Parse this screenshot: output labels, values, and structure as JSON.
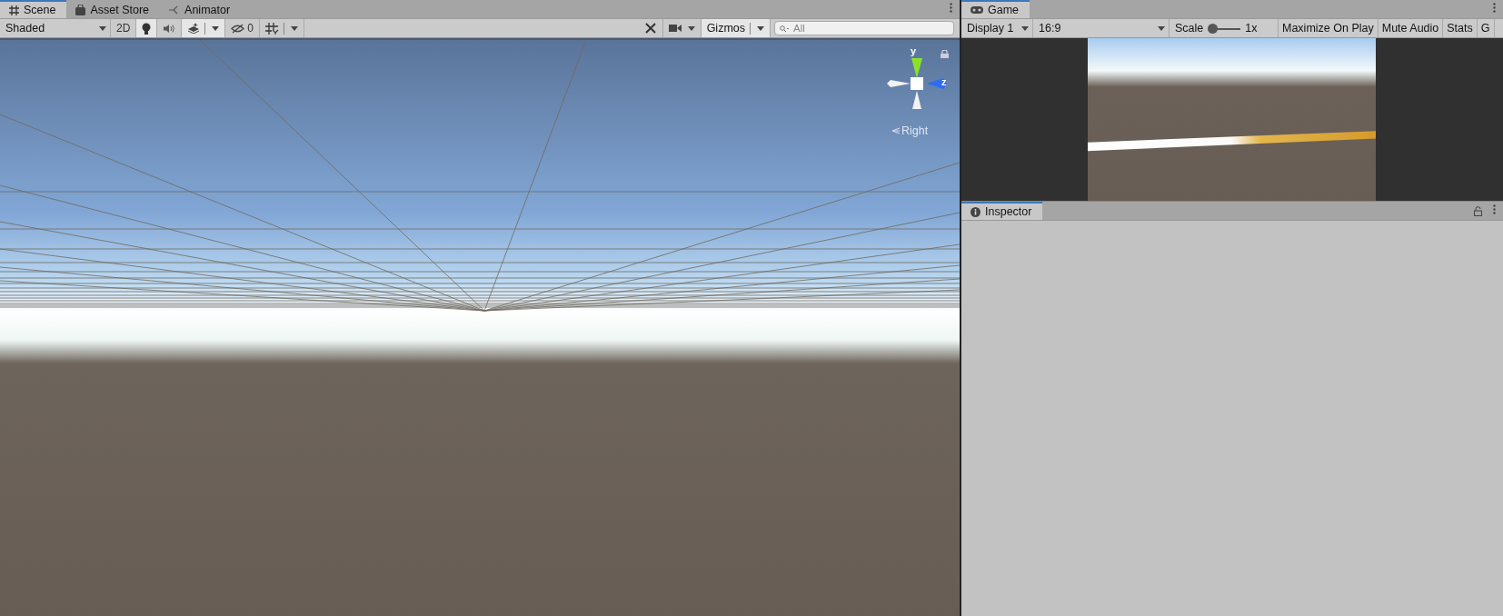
{
  "scene_panel": {
    "tabs": [
      {
        "label": "Scene",
        "selected": true
      },
      {
        "label": "Asset Store",
        "selected": false
      },
      {
        "label": "Animator",
        "selected": false
      }
    ],
    "toolbar": {
      "draw_mode": "Shaded",
      "toggles": [
        {
          "kind": "text",
          "label": "2D",
          "selected": false
        },
        {
          "kind": "light",
          "selected": true
        },
        {
          "kind": "audio",
          "selected": false
        },
        {
          "kind": "effects",
          "selected": true
        },
        {
          "kind": "hidden",
          "label": "0",
          "selected": false
        },
        {
          "kind": "grid",
          "selected": false
        }
      ],
      "gizmos": {
        "label": "Gizmos",
        "selected": true
      },
      "search": {
        "placeholder": "All"
      }
    },
    "gizmo": {
      "axes": [
        "y",
        "z"
      ],
      "view_label": "Right"
    }
  },
  "game_panel": {
    "tab": {
      "label": "Game",
      "selected": true
    },
    "display": "Display 1",
    "aspect": "16:9",
    "scale": {
      "label": "Scale",
      "level": 0,
      "reading": "1x"
    },
    "toggles": [
      {
        "label": "Maximize On Play",
        "selected": false
      },
      {
        "label": "Mute Audio",
        "selected": false
      },
      {
        "label": "Stats",
        "selected": false
      },
      {
        "label": "G",
        "selected": false
      }
    ]
  },
  "inspector": {
    "tab": {
      "label": "Inspector",
      "selected": true
    }
  }
}
